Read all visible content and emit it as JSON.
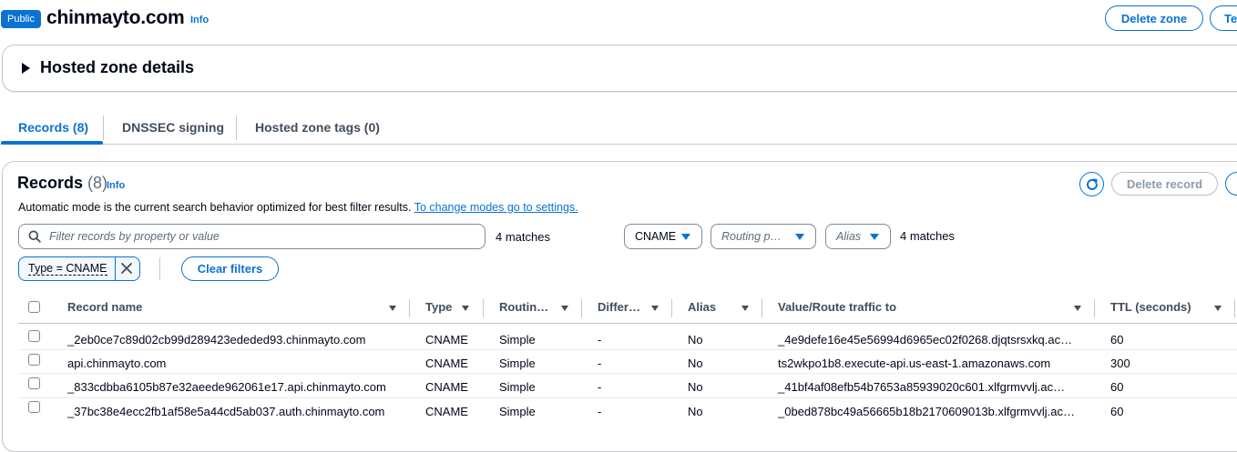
{
  "header": {
    "badge": "Public",
    "zone_name": "chinmayto.com",
    "info": "Info",
    "delete_zone": "Delete zone",
    "test_button": "Te"
  },
  "details": {
    "title": "Hosted zone details"
  },
  "tabs": [
    {
      "label": "Records (8)",
      "active": true
    },
    {
      "label": "DNSSEC signing",
      "active": false
    },
    {
      "label": "Hosted zone tags (0)",
      "active": false
    }
  ],
  "records": {
    "title": "Records",
    "count": "(8)",
    "info": "Info",
    "mode_text": "Automatic mode is the current search behavior optimized for best filter results. ",
    "mode_link": "To change modes go to settings.",
    "delete_record": "Delete record",
    "search_placeholder": "Filter records by property or value",
    "search_matches": "4 matches",
    "filters": {
      "type": "CNAME",
      "routing": "Routing p…",
      "alias": "Alias",
      "matches": "4 matches"
    },
    "token": "Type = CNAME",
    "clear_filters": "Clear filters",
    "columns": [
      "Record name",
      "Type",
      "Routin…",
      "Differ…",
      "Alias",
      "Value/Route traffic to",
      "TTL (seconds)"
    ],
    "rows": [
      {
        "name": "_2eb0ce7c89d02cb99d289423ededed93.chinmayto.com",
        "type": "CNAME",
        "routing": "Simple",
        "diff": "-",
        "alias": "No",
        "value": "_4e9defe16e45e56994d6965ec02f0268.djqtsrsxkq.ac…",
        "ttl": "60"
      },
      {
        "name": "api.chinmayto.com",
        "type": "CNAME",
        "routing": "Simple",
        "diff": "-",
        "alias": "No",
        "value": "ts2wkpo1b8.execute-api.us-east-1.amazonaws.com",
        "ttl": "300"
      },
      {
        "name": "_833cdbba6105b87e32aeede962061e17.api.chinmayto.com",
        "type": "CNAME",
        "routing": "Simple",
        "diff": "-",
        "alias": "No",
        "value": "_41bf4af08efb54b7653a85939020c601.xlfgrmvvlj.ac…",
        "ttl": "60"
      },
      {
        "name": "_37bc38e4ecc2fb1af58e5a44cd5ab037.auth.chinmayto.com",
        "type": "CNAME",
        "routing": "Simple",
        "diff": "-",
        "alias": "No",
        "value": "_0bed878bc49a56665b18b2170609013b.xlfgrmvvlj.ac…",
        "ttl": "60"
      }
    ]
  },
  "colors": {
    "accent": "#0972d3",
    "text": "#000716",
    "muted": "#5f6b7a",
    "border": "#c6c6cd"
  }
}
